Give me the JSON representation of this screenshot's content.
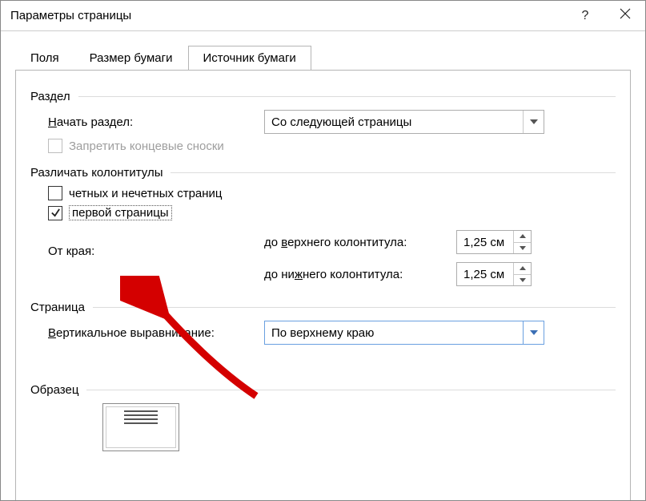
{
  "title": "Параметры страницы",
  "tabs": {
    "fields": "Поля",
    "paper_size": "Размер бумаги",
    "paper_source": "Источник бумаги"
  },
  "section_group": {
    "header": "Раздел",
    "start_label": "Начать раздел:",
    "start_value": "Со следующей страницы",
    "suppress_endnotes": "Запретить концевые сноски"
  },
  "headers_footers": {
    "header": "Различать колонтитулы",
    "odd_even": "четных и нечетных страниц",
    "first_page": "первой страницы",
    "from_edge": "От края:",
    "to_header_label": "до верхнего колонтитула:",
    "to_header_value": "1,25 см",
    "to_footer_label": "до нижнего колонтитула:",
    "to_footer_value": "1,25 см"
  },
  "page": {
    "header": "Страница",
    "valign_label": "Вертикальное выравнивание:",
    "valign_value": "По верхнему краю"
  },
  "preview": {
    "header": "Образец"
  }
}
